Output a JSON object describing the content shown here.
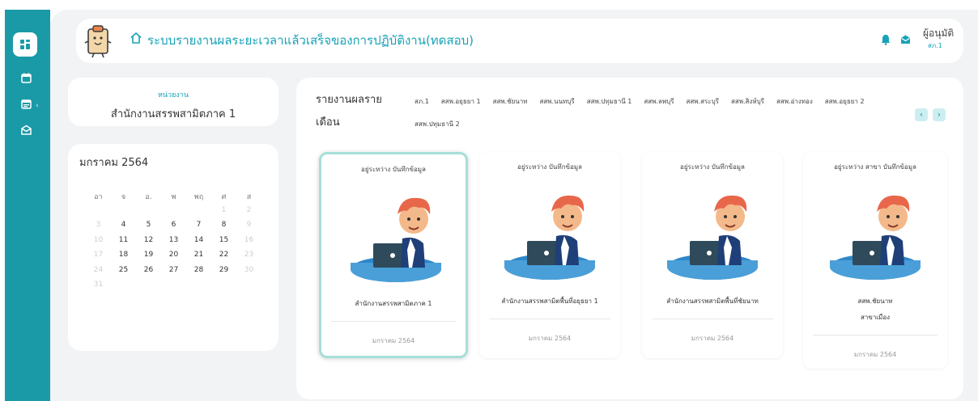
{
  "sidebar": {
    "icons": [
      "dashboard-icon",
      "calendar-icon",
      "calendar-list-icon",
      "mail-icon"
    ],
    "expand_glyph": "‹"
  },
  "header": {
    "title": "ระบบรายงานผลระยะเวลาแล้วเสร็จของการปฏิบัติงาน(ทดสอบ)",
    "user_role": "ผู้อนุมัติ",
    "user_unit": "สภ.1"
  },
  "unit": {
    "label": "หน่วยงาน",
    "name": "สำนักงานสรรพสามิตภาค 1"
  },
  "calendar": {
    "title": "มกราคม 2564",
    "weekdays": [
      "อา",
      "จ",
      "อ.",
      "พ",
      "พฤ",
      "ศ",
      "ส"
    ],
    "cells": [
      {
        "t": "",
        "dim": false
      },
      {
        "t": "",
        "dim": false
      },
      {
        "t": "",
        "dim": false
      },
      {
        "t": "",
        "dim": false
      },
      {
        "t": "",
        "dim": false
      },
      {
        "t": "1",
        "dim": true
      },
      {
        "t": "2",
        "dim": true
      },
      {
        "t": "3",
        "dim": true
      },
      {
        "t": "4",
        "dim": false
      },
      {
        "t": "5",
        "dim": false
      },
      {
        "t": "6",
        "dim": false
      },
      {
        "t": "7",
        "dim": false
      },
      {
        "t": "8",
        "dim": false
      },
      {
        "t": "9",
        "dim": true
      },
      {
        "t": "10",
        "dim": true
      },
      {
        "t": "11",
        "dim": false
      },
      {
        "t": "12",
        "dim": false
      },
      {
        "t": "13",
        "dim": false
      },
      {
        "t": "14",
        "dim": false
      },
      {
        "t": "15",
        "dim": false
      },
      {
        "t": "16",
        "dim": true
      },
      {
        "t": "17",
        "dim": true
      },
      {
        "t": "18",
        "dim": false
      },
      {
        "t": "19",
        "dim": false
      },
      {
        "t": "20",
        "dim": false
      },
      {
        "t": "21",
        "dim": false
      },
      {
        "t": "22",
        "dim": false
      },
      {
        "t": "23",
        "dim": true
      },
      {
        "t": "24",
        "dim": true
      },
      {
        "t": "25",
        "dim": false
      },
      {
        "t": "26",
        "dim": false
      },
      {
        "t": "27",
        "dim": false
      },
      {
        "t": "28",
        "dim": false
      },
      {
        "t": "29",
        "dim": false
      },
      {
        "t": "30",
        "dim": true
      },
      {
        "t": "31",
        "dim": true
      }
    ]
  },
  "report": {
    "title_line1": "รายงานผลราย",
    "title_line2": "เดือน",
    "tags": [
      "สภ.1",
      "สสพ.อยุธยา 1",
      "สสพ.ชัยนาท",
      "สสพ.นนทบุรี",
      "สสพ.ปทุมธานี 1",
      "สสพ.ลพบุรี",
      "สสพ.สระบุรี",
      "สสพ.สิงห์บุรี",
      "สสพ.อ่างทอง",
      "สสพ.อยุธยา 2",
      "สสพ.ปทุมธานี 2"
    ],
    "prev": "‹",
    "next": "›",
    "cards": [
      {
        "status": "อยู่ระหว่าง บันทึกข้อมูล",
        "name": "สำนักงานสรรพสามิตภาค 1",
        "name2": "",
        "period": "มกราคม 2564",
        "selected": true
      },
      {
        "status": "อยู่ระหว่าง บันทึกข้อมูล",
        "name": "สำนักงานสรรพสามิตพื้นที่อยุธยา 1",
        "name2": "",
        "period": "มกราคม 2564",
        "selected": false
      },
      {
        "status": "อยู่ระหว่าง บันทึกข้อมูล",
        "name": "สำนักงานสรรพสามิตพื้นที่ชัยนาท",
        "name2": "",
        "period": "มกราคม 2564",
        "selected": false
      },
      {
        "status": "อยู่ระหว่าง สาขา บันทึกข้อมูล",
        "name": "สสพ.ชัยนาท",
        "name2": "สาขาเมือง",
        "period": "มกราคม 2564",
        "selected": false
      }
    ]
  },
  "colors": {
    "accent": "#17a2b8",
    "rail": "#1a9aa6",
    "background": "#f1f3f5"
  }
}
